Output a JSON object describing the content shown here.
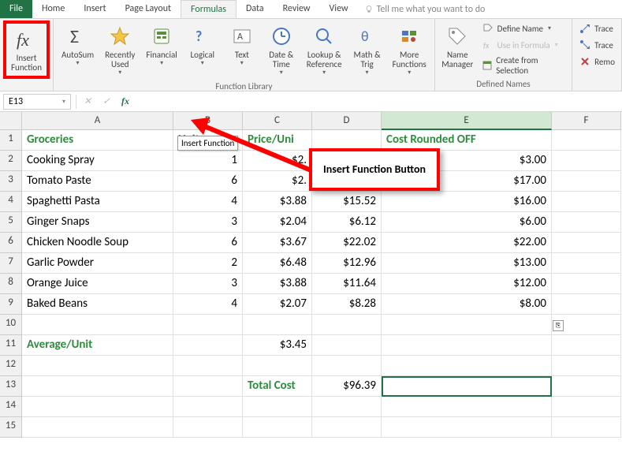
{
  "tabs": {
    "file": "File",
    "home": "Home",
    "insert": "Insert",
    "page_layout": "Page Layout",
    "formulas": "Formulas",
    "data": "Data",
    "review": "Review",
    "view": "View",
    "tell_me": "Tell me what you want to do"
  },
  "ribbon": {
    "insert_function": "Insert\nFunction",
    "autosum": "AutoSum",
    "recently_used": "Recently\nUsed",
    "financial": "Financial",
    "logical": "Logical",
    "text": "Text",
    "date_time": "Date &\nTime",
    "lookup_ref": "Lookup &\nReference",
    "math_trig": "Math &\nTrig",
    "more_functions": "More\nFunctions",
    "name_manager": "Name\nManager",
    "define_name": "Define Name",
    "use_in_formula": "Use in Formula",
    "create_from_selection": "Create from Selection",
    "trace1": "Trace",
    "trace2": "Trace",
    "remo": "Remo",
    "group_function_library": "Function Library",
    "group_defined_names": "Defined Names"
  },
  "namebox": "E13",
  "tooltip": "Insert Function",
  "callout": "Insert Function\nButton",
  "columns": [
    "A",
    "B",
    "C",
    "D",
    "E",
    "F"
  ],
  "headers": {
    "A": "Groceries",
    "B": "Units",
    "C": "Price/Uni",
    "D": "",
    "E": "Cost Rounded OFF"
  },
  "rows": [
    {
      "a": "Cooking Spray",
      "b": "1",
      "c": "$2.",
      "d": "",
      "e": "$3.00"
    },
    {
      "a": "Tomato Paste",
      "b": "6",
      "c": "$2.",
      "d": "",
      "e": "$17.00"
    },
    {
      "a": "Spaghetti Pasta",
      "b": "4",
      "c": "$3.88",
      "d": "$15.52",
      "e": "$16.00"
    },
    {
      "a": "Ginger Snaps",
      "b": "3",
      "c": "$2.04",
      "d": "$6.12",
      "e": "$6.00"
    },
    {
      "a": "Chicken Noodle Soup",
      "b": "6",
      "c": "$3.67",
      "d": "$22.02",
      "e": "$22.00"
    },
    {
      "a": "Garlic Powder",
      "b": "2",
      "c": "$6.48",
      "d": "$12.96",
      "e": "$13.00"
    },
    {
      "a": "Orange Juice",
      "b": "3",
      "c": "$3.88",
      "d": "$11.64",
      "e": "$12.00"
    },
    {
      "a": "Baked Beans",
      "b": "4",
      "c": "$2.07",
      "d": "$8.28",
      "e": "$8.00"
    }
  ],
  "avg_label": "Average/Unit",
  "avg_value": "$3.45",
  "total_label": "Total Cost",
  "total_value": "$96.39"
}
